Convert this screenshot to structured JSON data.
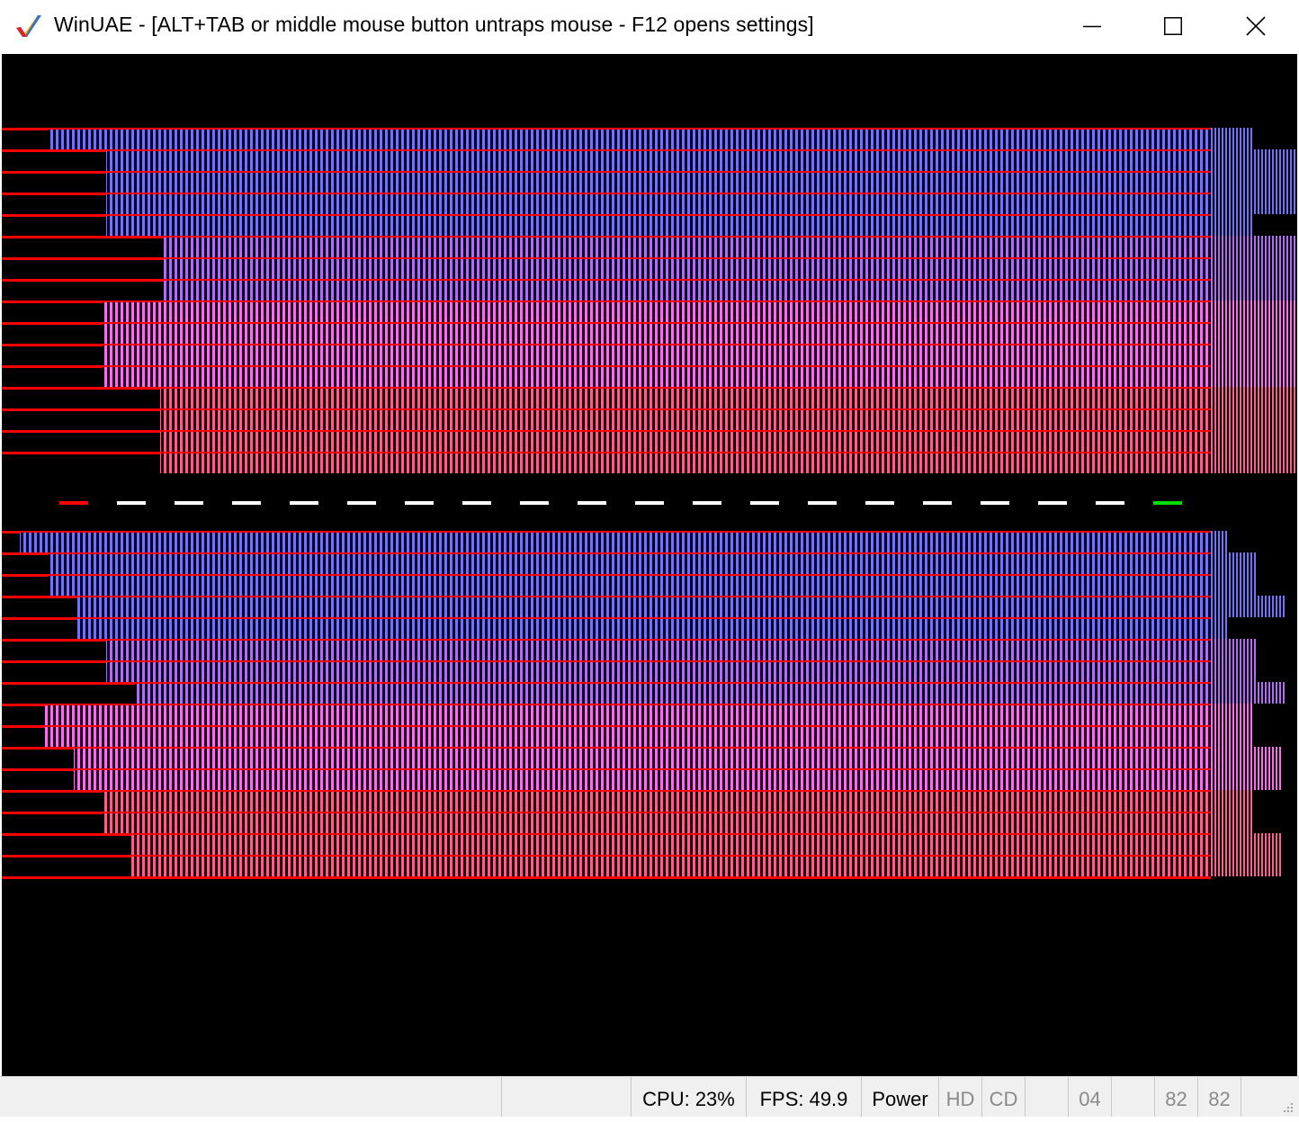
{
  "window": {
    "title": "WinUAE - [ALT+TAB or middle mouse button untraps mouse - F12 opens settings]",
    "controls": {
      "minimize_icon": "minimize-icon",
      "maximize_icon": "maximize-icon",
      "close_icon": "close-icon"
    }
  },
  "emulator_display": {
    "content": "copper-bars-test-pattern",
    "colors": {
      "background": "#000000",
      "red_line": "#ff0000",
      "band_blue": "#7272ff",
      "band_violet": "#b06cf4",
      "band_pink": "#ff6cf0",
      "band_rose": "#ff5c90",
      "dash_white": "#ffffff",
      "dash_red": "#ff0000",
      "dash_green": "#00e000"
    }
  },
  "statusbar": {
    "cpu": "CPU: 23%",
    "fps": "FPS: 49.9",
    "power": "Power",
    "hd": "HD",
    "cd": "CD",
    "df0": "04",
    "df2": "82",
    "df3": "82"
  }
}
